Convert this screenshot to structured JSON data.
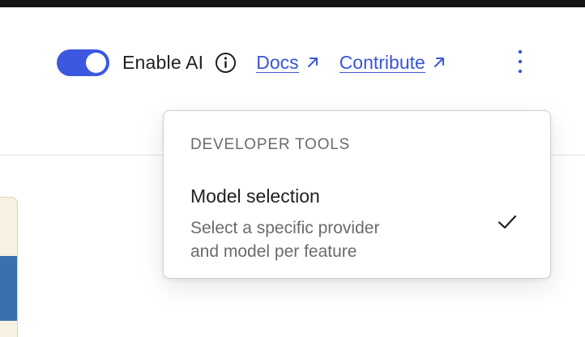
{
  "toolbar": {
    "toggle_label": "Enable AI",
    "toggle_state": "on",
    "docs_label": "Docs",
    "contribute_label": "Contribute"
  },
  "icons": {
    "info": "info-icon",
    "external": "external-link-icon",
    "more": "more-vertical-icon",
    "check": "check-icon"
  },
  "colors": {
    "accent": "#3c58e0",
    "link": "#3b55d9",
    "muted_text": "#6b6b6b"
  },
  "menu": {
    "heading": "DEVELOPER TOOLS",
    "items": [
      {
        "title": "Model selection",
        "description_line1": "Select a specific provider",
        "description_line2": "and model per feature",
        "checked": true
      }
    ]
  }
}
